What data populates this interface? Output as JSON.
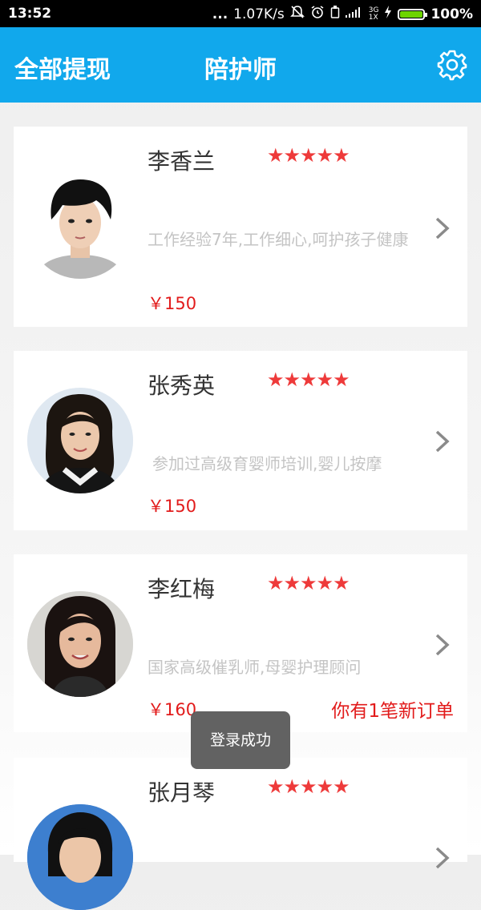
{
  "status_bar": {
    "time": "13:52",
    "dots": "...",
    "speed": "1.07K/s",
    "network_top": "3G",
    "network_bottom": "1X",
    "battery_percent": "100%",
    "battery_level": 1.0,
    "battery_color": "#6dd400"
  },
  "app_bar": {
    "left_action": "全部提现",
    "title": "陪护师",
    "right_icon": "gear-icon",
    "color": "#11a8ec"
  },
  "caregivers": [
    {
      "name": "李香兰",
      "stars": "★★★★★",
      "description": "工作经验7年,工作细心,呵护孩子健康",
      "price": "￥150",
      "notice": ""
    },
    {
      "name": "张秀英",
      "stars": "★★★★★",
      "description": "参加过高级育婴师培训,婴儿按摩",
      "price": "￥150",
      "notice": ""
    },
    {
      "name": "李红梅",
      "stars": "★★★★★",
      "description": "国家高级催乳师,母婴护理顾问",
      "price": "￥160",
      "notice": "你有1笔新订单"
    },
    {
      "name": "张月琴",
      "stars": "★★★★★",
      "description": "",
      "price": "",
      "notice": ""
    }
  ],
  "toast": {
    "text": "登录成功"
  },
  "accent_red": "#e21b1b"
}
